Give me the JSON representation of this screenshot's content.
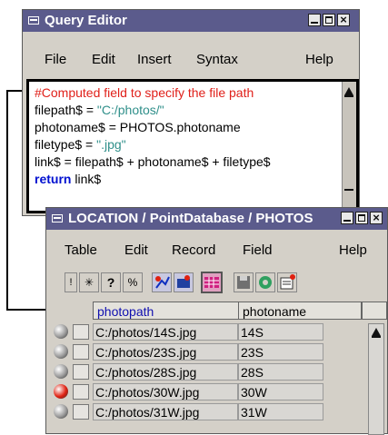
{
  "query_editor": {
    "title": "Query Editor",
    "menu": [
      "File",
      "Edit",
      "Insert",
      "Syntax",
      "Help"
    ],
    "code": {
      "comment": "#Computed field to specify the file path",
      "line2_var": "filepath$ = ",
      "line2_str": "\"C:/photos/\"",
      "line3": "photoname$ = PHOTOS.photoname",
      "line4_var": "filetype$ = ",
      "line4_str": "\".jpg\"",
      "line5": "link$ = filepath$ + photoname$ + filetype$",
      "line6_kw": "return",
      "line6_rest": " link$"
    }
  },
  "table_window": {
    "title": "LOCATION / PointDatabase / PHOTOS",
    "menu": [
      "Table",
      "Edit",
      "Record",
      "Field",
      "Help"
    ],
    "toolbar_icons": [
      "sort-icon",
      "wand-icon",
      "question-icon",
      "percent-icon",
      "star-select-icon",
      "select-records-icon",
      "table-grid-icon",
      "save-icon",
      "link-icon",
      "new-record-icon"
    ],
    "columns": [
      "photopath",
      "photoname"
    ],
    "rows": [
      {
        "photopath": "C:/photos/14S.jpg",
        "photoname": "14S",
        "marker": "#9a9a9a"
      },
      {
        "photopath": "C:/photos/23S.jpg",
        "photoname": "23S",
        "marker": "#9a9a9a"
      },
      {
        "photopath": "C:/photos/28S.jpg",
        "photoname": "28S",
        "marker": "#9a9a9a"
      },
      {
        "photopath": "C:/photos/30W.jpg",
        "photoname": "30W",
        "marker": "#e02010"
      },
      {
        "photopath": "C:/photos/31W.jpg",
        "photoname": "31W",
        "marker": "#9a9a9a"
      }
    ]
  },
  "colors": {
    "titlebar": "#5b5b8c",
    "comment": "#e0201a",
    "string": "#2f8f8a",
    "keyword": "#0010d0",
    "selected_marker": "#e02010"
  }
}
